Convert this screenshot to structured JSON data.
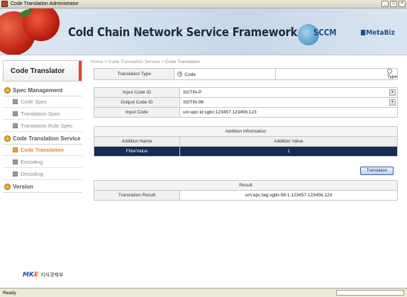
{
  "window": {
    "title": "Code Translation Administrator",
    "buttons": {
      "minimize": "_",
      "maximize": "□",
      "close": "×"
    }
  },
  "banner": {
    "headline": "Cold Chain Network Service Framework",
    "logo_sccm": "SCCM",
    "logo_metabiz": "MetaBiz"
  },
  "sidebar": {
    "title": "Code Translator",
    "sections": [
      {
        "label": "Spec Management",
        "icon": "gear-icon"
      },
      {
        "label": "Code Translation Service",
        "icon": "gear-icon"
      },
      {
        "label": "Version",
        "icon": "gear-icon"
      }
    ],
    "items": [
      {
        "label": "Code Spec",
        "active": false
      },
      {
        "label": "Translation Spec",
        "active": false
      },
      {
        "label": "Translation Rule Spec",
        "active": false
      },
      {
        "label": "Code Translation",
        "active": true
      },
      {
        "label": "Encoding",
        "active": false
      },
      {
        "label": "Decoding",
        "active": false
      }
    ],
    "footer_logo": {
      "mark_m": "M",
      "mark_k": "K",
      "mark_e": "E",
      "text": "지식경제부"
    }
  },
  "breadcrumb": {
    "home": "Home",
    "sep1": ">",
    "section": "Code Translation Service",
    "sep2": ">",
    "current": "Code Translation"
  },
  "form": {
    "translation_type_label": "Translation Type",
    "option_code": "Code",
    "option_type": "Type",
    "selected_option": "Code",
    "input_code_id_label": "Input Code ID",
    "input_code_id_value": "SGTIN-P",
    "output_code_id_label": "Output Code ID",
    "output_code_id_value": "SGTIN-96",
    "input_code_label": "Input Code",
    "input_code_value": "urn:epc:id:sgtin:123457.123456.123"
  },
  "addition": {
    "title": "Addition Information",
    "col_name": "Addition Name",
    "col_value": "Addition Value",
    "rows": [
      {
        "name": "FilterValue",
        "value": "1"
      }
    ]
  },
  "translate_button": "Translation",
  "result": {
    "title": "Result",
    "label": "Translation Result",
    "value": "urn:epc:tag:sgtin-96:1.123457.123456.123"
  },
  "statusbar": {
    "text": "Ready"
  }
}
